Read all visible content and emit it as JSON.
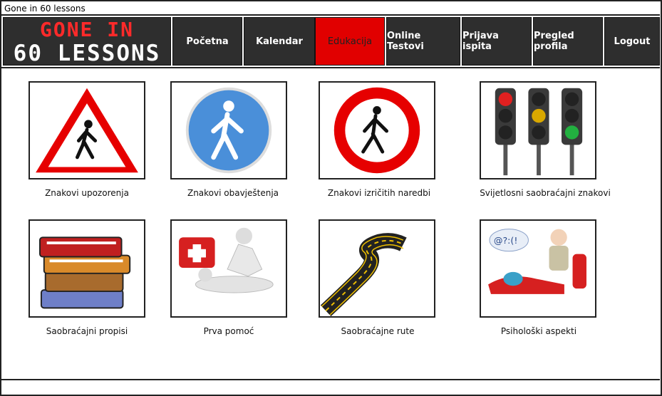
{
  "window": {
    "title": "Gone in 60 lessons"
  },
  "logo": {
    "line1": "GONE IN",
    "line2": "60 LESSONS"
  },
  "nav": {
    "items": [
      {
        "label": "Početna"
      },
      {
        "label": "Kalendar"
      },
      {
        "label": "Edukacija",
        "active": true
      },
      {
        "label": "Online Testovi"
      },
      {
        "label": "Prijava ispita"
      },
      {
        "label": "Pregled profila"
      },
      {
        "label": "Logout"
      }
    ]
  },
  "tiles": [
    {
      "label": "Znakovi upozorenja",
      "icon": "warning-sign-icon"
    },
    {
      "label": "Znakovi obavještenja",
      "icon": "information-sign-icon"
    },
    {
      "label": "Znakovi izričitih naredbi",
      "icon": "prohibition-sign-icon"
    },
    {
      "label": "Svijetlosni saobraćajni znakovi",
      "icon": "traffic-light-icon"
    },
    {
      "label": "Saobraćajni propisi",
      "icon": "books-icon"
    },
    {
      "label": "Prva pomoć",
      "icon": "first-aid-icon"
    },
    {
      "label": "Saobraćajne rute",
      "icon": "road-icon"
    },
    {
      "label": "Psihološki aspekti",
      "icon": "psychologist-icon"
    }
  ],
  "colors": {
    "accent": "#e10000",
    "nav_bg": "#2e2e2e",
    "logo_red": "#ff2a2a"
  }
}
